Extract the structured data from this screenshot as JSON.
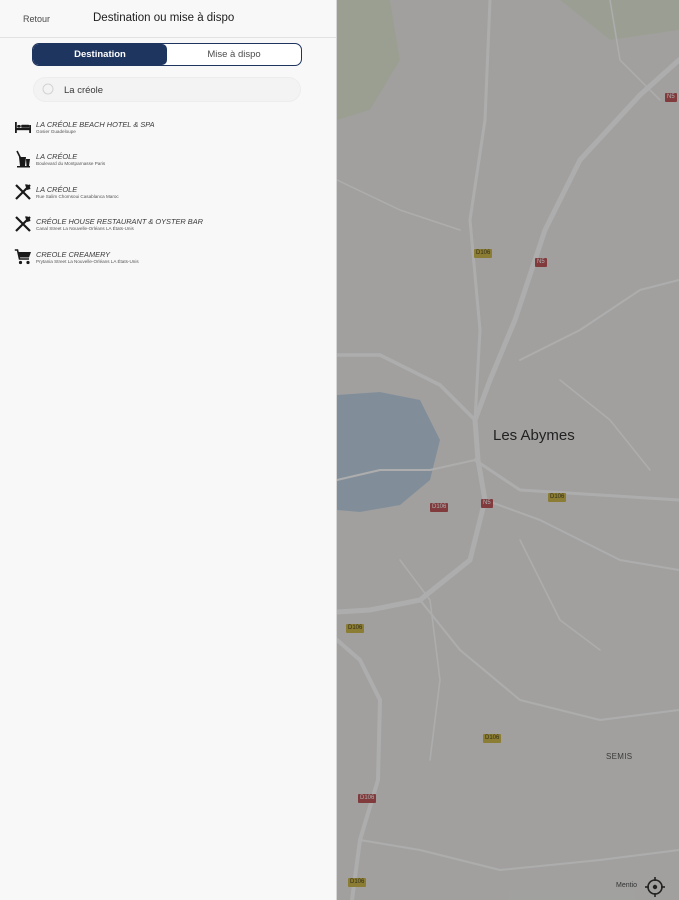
{
  "header": {
    "back_label": "Retour",
    "title": "Destination ou mise à dispo"
  },
  "tabs": [
    {
      "label": "Destination",
      "active": true
    },
    {
      "label": "Mise à dispo",
      "active": false
    }
  ],
  "search": {
    "value": "La créole",
    "icon": "search-icon"
  },
  "results": [
    {
      "icon": "hotel-bed-icon",
      "name": "LA CRÉOLE BEACH HOTEL & SPA",
      "address": "Gosier Guadeloupe"
    },
    {
      "icon": "bar-drink-icon",
      "name": "LA CRÉOLE",
      "address": "Boulevard du Montparnasse Paris"
    },
    {
      "icon": "restaurant-cutlery-icon",
      "name": "LA CRÉOLE",
      "address": "Rue Salim Chomsoui Casablanca Maroc"
    },
    {
      "icon": "restaurant-cutlery-icon",
      "name": "CRÉOLE HOUSE RESTAURANT & OYSTER BAR",
      "address": "Canal Street La Nouvelle-Orléans LA États-Unis"
    },
    {
      "icon": "shopping-cart-icon",
      "name": "CREOLE CREAMERY",
      "address": "Prytania Street La Nouvelle-Orléans LA États-Unis"
    }
  ],
  "map": {
    "city_label": "Les Abymes",
    "place_label": "SEMIS",
    "legal_label": "Mentio",
    "locate_icon": "crosshair-icon",
    "road_badges": [
      "N5",
      "N5",
      "N5",
      "D106",
      "D106",
      "D106",
      "D106",
      "D106",
      "D106",
      "D106"
    ]
  },
  "colors": {
    "accent": "#1e3560",
    "panel_bg": "#f8f8f8"
  }
}
